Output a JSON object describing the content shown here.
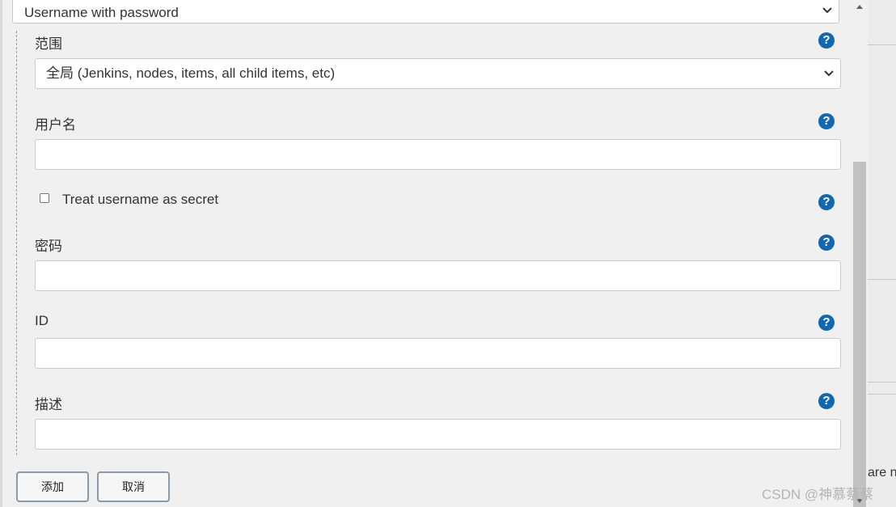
{
  "kind_select": {
    "value": "Username with password"
  },
  "scope": {
    "label": "范围",
    "value": "全局 (Jenkins, nodes, items, all child items, etc)",
    "help": "?"
  },
  "username": {
    "label": "用户名",
    "value": "",
    "help": "?"
  },
  "treat_secret": {
    "label": "Treat username as secret",
    "checked": false,
    "help": "?"
  },
  "password": {
    "label": "密码",
    "value": "",
    "help": "?"
  },
  "id_field": {
    "label": "ID",
    "value": "",
    "help": "?"
  },
  "description": {
    "label": "描述",
    "value": "",
    "help": "?"
  },
  "buttons": {
    "add": "添加",
    "cancel": "取消"
  },
  "background": {
    "partial_text": "are no"
  },
  "watermark": "CSDN @神慕蔡蔡",
  "colors": {
    "help_icon": "#1168b0",
    "border": "#cccccc",
    "background": "#f0f0f0"
  }
}
